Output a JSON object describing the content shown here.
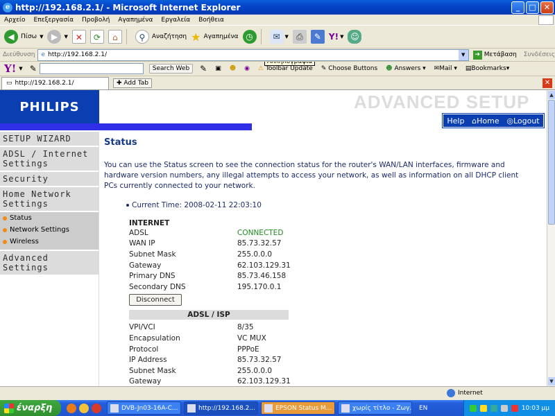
{
  "window": {
    "title": "http://192.168.2.1/ - Microsoft Internet Explorer"
  },
  "menu": [
    "Αρχείο",
    "Επεξεργασία",
    "Προβολή",
    "Αγαπημένα",
    "Εργαλεία",
    "Βοήθεια"
  ],
  "toolbar": {
    "back": "Πίσω",
    "search": "Αναζήτηση",
    "favorites": "Αγαπημένα"
  },
  "tooltip": "Αλληλογραφία",
  "address": {
    "label": "Διεύθυνση",
    "url": "http://192.168.2.1/",
    "go": "Μετάβαση",
    "links": "Συνδέσεις"
  },
  "yahoo": {
    "logo": "Y!",
    "search_web": "Search Web",
    "toolbar_update": "Toolbar Update",
    "choose_buttons": "Choose Buttons",
    "answers": "Answers",
    "mail": "Mail",
    "bookmarks": "Bookmarks"
  },
  "tabs": {
    "current": "http://192.168.2.1/",
    "add": "Add Tab"
  },
  "page": {
    "brand": "PHILIPS",
    "header": "ADVANCED SETUP",
    "links": {
      "help": "Help",
      "home": "Home",
      "logout": "Logout"
    },
    "sidebar": {
      "setup_wizard": "SETUP WIZARD",
      "adsl_internet": "ADSL / Internet Settings",
      "security": "Security",
      "home_network": "Home Network Settings",
      "sub": [
        "Status",
        "Network Settings",
        "Wireless"
      ],
      "advanced": "Advanced Settings"
    },
    "title": "Status",
    "description": "You can use the Status screen to see the connection status for the router's WAN/LAN interfaces, firmware and hardware version numbers, any illegal attempts to access your network, as well as information on all DHCP client PCs currently connected to your network.",
    "current_time_label": "Current Time:",
    "current_time": "2008-02-11 22:03:10",
    "internet": {
      "heading": "INTERNET",
      "rows": [
        {
          "k": "ADSL",
          "v": "CONNECTED"
        },
        {
          "k": "WAN IP",
          "v": "85.73.32.57"
        },
        {
          "k": "Subnet Mask",
          "v": "255.0.0.0"
        },
        {
          "k": "Gateway",
          "v": "62.103.129.31"
        },
        {
          "k": "Primary DNS",
          "v": "85.73.46.158"
        },
        {
          "k": "Secondary DNS",
          "v": "195.170.0.1"
        }
      ],
      "disconnect": "Disconnect"
    },
    "adsl": {
      "heading": "ADSL / ISP",
      "rows": [
        {
          "k": "VPI/VCI",
          "v": "8/35"
        },
        {
          "k": "Encapsulation",
          "v": "VC MUX"
        },
        {
          "k": "Protocol",
          "v": "PPPoE"
        },
        {
          "k": "IP Address",
          "v": "85.73.32.57"
        },
        {
          "k": "Subnet Mask",
          "v": "255.0.0.0"
        },
        {
          "k": "Gateway",
          "v": "62.103.129.31"
        }
      ]
    }
  },
  "status": {
    "zone": "Internet"
  },
  "taskbar": {
    "start": "έναρξη",
    "tasks": [
      "DVB-Jn03-16A-C...",
      "http://192.168.2...",
      "EPSON Status M...",
      "χωρίς τίτλο - Ζωγ..."
    ],
    "lang": "EN",
    "clock": "10:03 μμ"
  }
}
